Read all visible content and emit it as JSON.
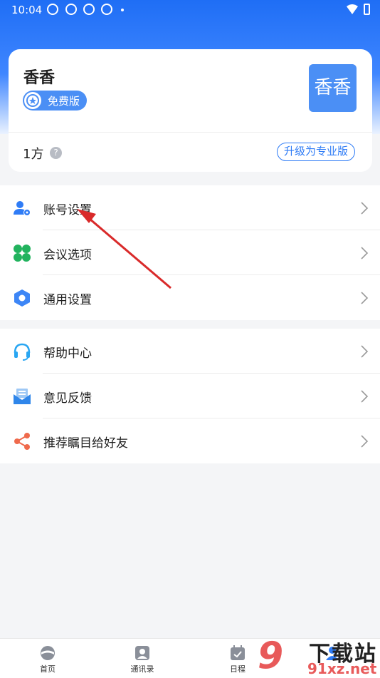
{
  "status_bar": {
    "time": "10:04"
  },
  "profile": {
    "name": "香香",
    "plan_badge": "免费版",
    "avatar_text": "香香",
    "quota": "1方",
    "help_glyph": "?",
    "upgrade_label": "升级为专业版"
  },
  "menu_groups": [
    {
      "items": [
        {
          "label": "账号设置",
          "icon": "account-settings-icon",
          "color": "#2f7cf6"
        },
        {
          "label": "会议选项",
          "icon": "clover-icon",
          "color": "#22b35e"
        },
        {
          "label": "通用设置",
          "icon": "hexagon-settings-icon",
          "color": "#3d86f6"
        }
      ]
    },
    {
      "items": [
        {
          "label": "帮助中心",
          "icon": "headset-icon",
          "color": "#29a6f2"
        },
        {
          "label": "意见反馈",
          "icon": "feedback-mail-icon",
          "color": "#2f86ea"
        },
        {
          "label": "推荐瞩目给好友",
          "icon": "share-icon",
          "color": "#ef6a4c"
        }
      ]
    }
  ],
  "tabs": [
    {
      "label": "首页",
      "icon": "home-logo-icon"
    },
    {
      "label": "通讯录",
      "icon": "contacts-icon"
    },
    {
      "label": "日程",
      "icon": "calendar-icon"
    },
    {
      "label": "",
      "icon": "me-icon"
    }
  ],
  "watermark": {
    "digits": "9",
    "top_text": "下载站",
    "url": "91xz.net"
  },
  "colors": {
    "brand_blue": "#2f7cf6",
    "arrow_red": "#d92a2a"
  }
}
